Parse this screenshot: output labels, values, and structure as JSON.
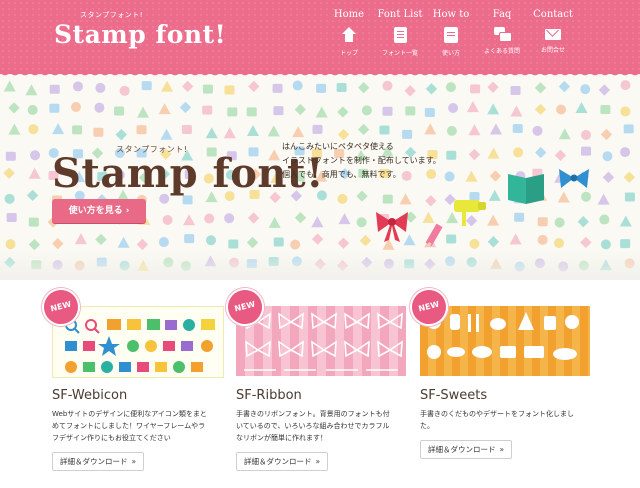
{
  "header": {
    "logo_kana": "スタンプフォント!",
    "logo_text": "Stamp font!",
    "nav": [
      {
        "en": "Home",
        "jp": "トップ",
        "icon": "home-icon"
      },
      {
        "en": "Font List",
        "jp": "フォント一覧",
        "icon": "list-icon"
      },
      {
        "en": "How to",
        "jp": "使い方",
        "icon": "howto-icon"
      },
      {
        "en": "Faq",
        "jp": "よくある質問",
        "icon": "faq-icon"
      },
      {
        "en": "Contact",
        "jp": "お問合せ",
        "icon": "mail-icon"
      }
    ]
  },
  "hero": {
    "kana": "スタンプフォント!",
    "title": "Stamp font!",
    "desc": [
      "はんこみたいにペタペタ使える",
      "イラストフォントを制作・配布しています。",
      "個人でも、商用でも、無料です。"
    ],
    "howto_button": "使い方を見る ›"
  },
  "products": [
    {
      "badge": "NEW",
      "title": "SF-Webicon",
      "desc": [
        "Webサイトのデザインに便利なアイコン類をまと",
        "めてフォントにしました！ワイヤーフレームやラ",
        "フデザイン作りにもお役立てください"
      ],
      "button": "詳細＆ダウンロード",
      "button_arrow": "»"
    },
    {
      "badge": "NEW",
      "title": "SF-Ribbon",
      "desc": [
        "手書きのリボンフォント。背景用のフォントも付",
        "いているので、いろいろな組み合わせでカラフル",
        "なリボンが簡単に作れます！"
      ],
      "button": "詳細＆ダウンロード",
      "button_arrow": "»"
    },
    {
      "badge": "NEW",
      "title": "SF-Sweets",
      "desc": [
        "手書きのくだものやデザートをフォント化しまし",
        "た。"
      ],
      "button": "詳細＆ダウンロード",
      "button_arrow": "»"
    }
  ],
  "colors": {
    "header": "#ec6c8c",
    "button": "#e86a87",
    "title_brown": "#5d3a2a"
  }
}
